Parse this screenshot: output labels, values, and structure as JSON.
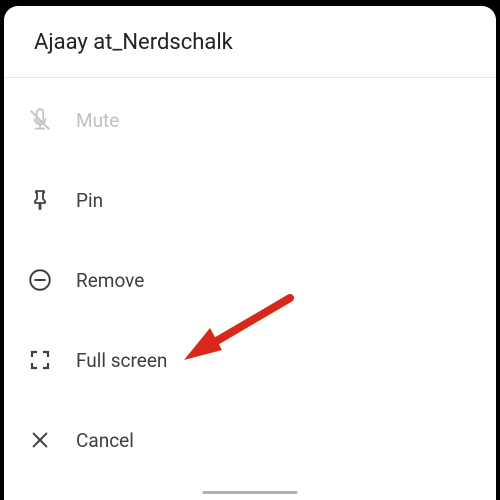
{
  "header": {
    "title": "Ajaay at_Nerdschalk"
  },
  "menu": {
    "mute": {
      "label": "Mute"
    },
    "pin": {
      "label": "Pin"
    },
    "remove": {
      "label": "Remove"
    },
    "fullscreen": {
      "label": "Full screen"
    },
    "cancel": {
      "label": "Cancel"
    }
  },
  "colors": {
    "arrow": "#d8281a",
    "icon_active": "#3c4043",
    "icon_disabled": "#c4c4c4"
  }
}
